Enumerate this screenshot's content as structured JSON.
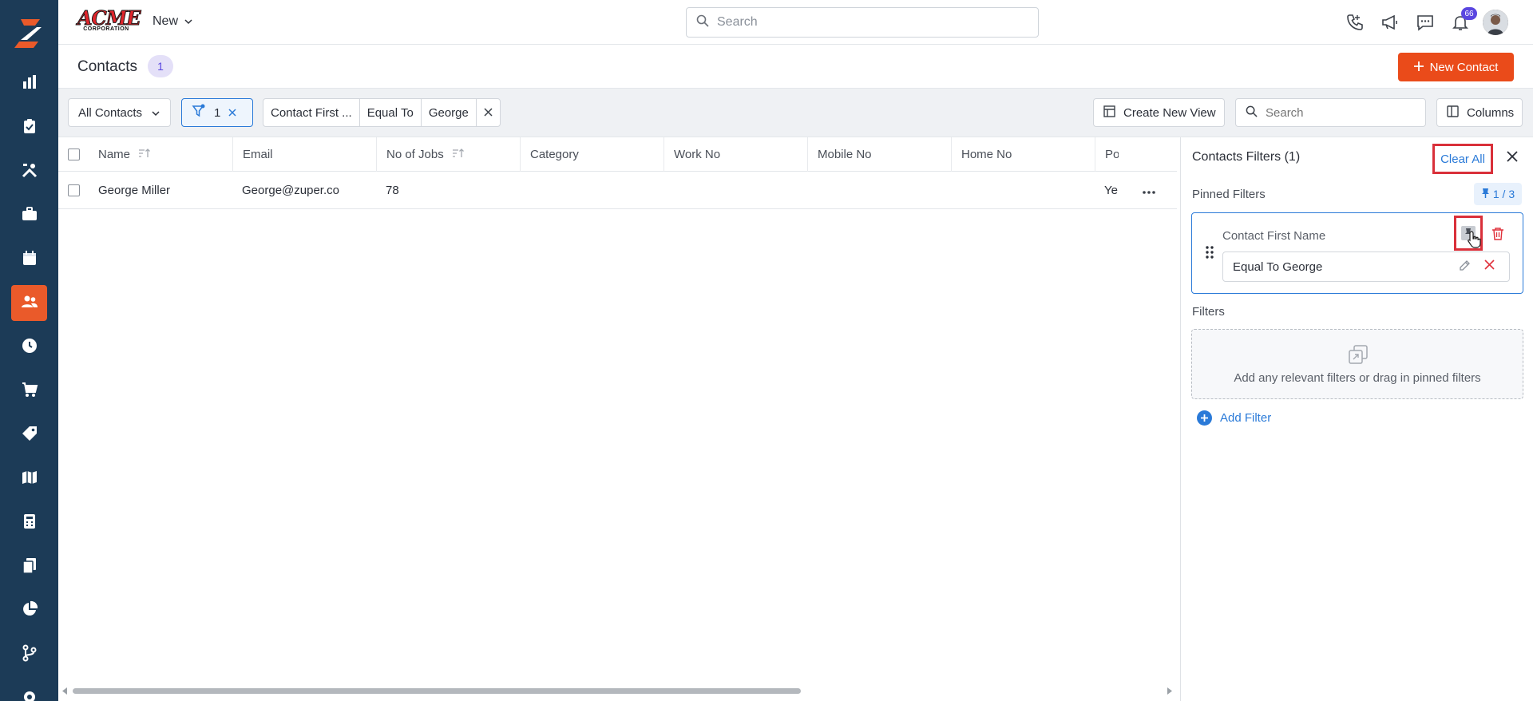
{
  "app": {
    "brand_name": "ACME",
    "brand_sub": "CORPORATION",
    "new_menu_label": "New",
    "search_placeholder": "Search",
    "notification_count": "66",
    "colors": {
      "sidebar": "#1c3b57",
      "accent": "#ea4b1a",
      "link": "#2a7ad8",
      "highlight": "#d9303a"
    }
  },
  "sidebar": {
    "items": [
      {
        "icon": "bar-chart-icon",
        "active": false
      },
      {
        "icon": "clipboard-check-icon",
        "active": false
      },
      {
        "icon": "tools-icon",
        "active": false
      },
      {
        "icon": "briefcase-icon",
        "active": false
      },
      {
        "icon": "calendar-icon",
        "active": false
      },
      {
        "icon": "contacts-icon",
        "active": true
      },
      {
        "icon": "clock-icon",
        "active": false
      },
      {
        "icon": "cart-icon",
        "active": false
      },
      {
        "icon": "tag-icon",
        "active": false
      },
      {
        "icon": "map-icon",
        "active": false
      },
      {
        "icon": "calculator-icon",
        "active": false
      },
      {
        "icon": "documents-icon",
        "active": false
      },
      {
        "icon": "pie-chart-icon",
        "active": false
      },
      {
        "icon": "branch-icon",
        "active": false
      },
      {
        "icon": "settings-icon",
        "active": false
      }
    ]
  },
  "header": {
    "title": "Contacts",
    "count": "1",
    "new_contact_label": "New Contact"
  },
  "filterbar": {
    "view_label": "All Contacts",
    "filter_count": "1",
    "chip_field": "Contact First ...",
    "chip_operator": "Equal To",
    "chip_value": "George",
    "create_view_label": "Create New View",
    "search_placeholder": "Search",
    "columns_label": "Columns"
  },
  "table": {
    "columns": [
      "Name",
      "Email",
      "No of Jobs",
      "Category",
      "Work No",
      "Mobile No",
      "Home No",
      "Po"
    ],
    "rows": [
      {
        "name": "George Miller",
        "email": "George@zuper.co",
        "jobs": "78",
        "category": "",
        "work": "",
        "mobile": "",
        "home": "",
        "extra": "Ye"
      }
    ]
  },
  "panel": {
    "title": "Contacts Filters (1)",
    "clear_all_label": "Clear All",
    "pinned_label": "Pinned Filters",
    "pinned_count": "1 / 3",
    "pinned_filter_field": "Contact First Name",
    "pinned_filter_value": "Equal To George",
    "filters_label": "Filters",
    "drop_text": "Add any relevant filters or drag in pinned filters",
    "add_filter_label": "Add Filter"
  }
}
